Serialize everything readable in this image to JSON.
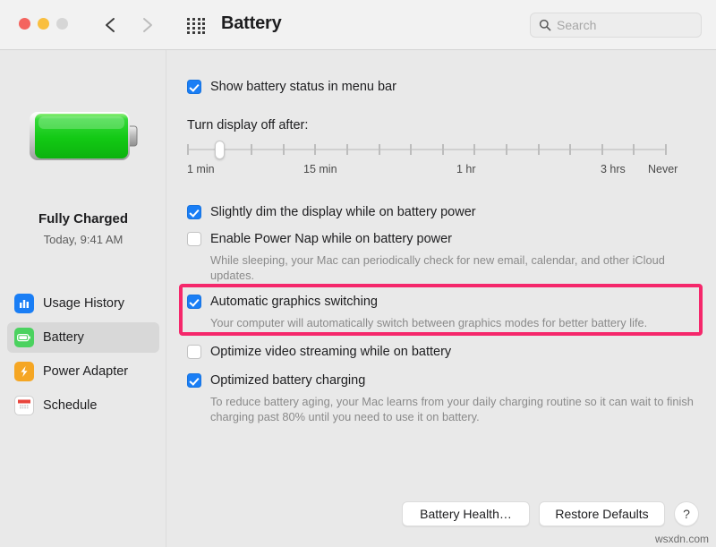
{
  "window": {
    "title": "Battery",
    "traffic_lights": [
      "close",
      "minimize",
      "zoom"
    ],
    "back_icon": "chevron-left-icon",
    "forward_icon": "chevron-right-icon",
    "grid_icon": "show-all-grid-icon"
  },
  "search": {
    "placeholder": "Search",
    "value": "",
    "icon": "search-icon"
  },
  "sidebar": {
    "battery_icon": "battery-full-green-icon",
    "status_title": "Fully Charged",
    "status_sub": "Today, 9:41 AM",
    "items": [
      {
        "label": "Usage History",
        "icon": "usage-history-icon",
        "selected": false
      },
      {
        "label": "Battery",
        "icon": "battery-icon",
        "selected": true
      },
      {
        "label": "Power Adapter",
        "icon": "power-adapter-bolt-icon",
        "selected": false
      },
      {
        "label": "Schedule",
        "icon": "schedule-calendar-icon",
        "selected": false
      }
    ]
  },
  "main": {
    "show_status": {
      "label": "Show battery status in menu bar",
      "checked": true
    },
    "display_off": {
      "label": "Turn display off after:",
      "ticks": 16,
      "thumb_index": 1,
      "scale_labels": [
        {
          "text": "1 min",
          "pos": 0
        },
        {
          "text": "15 min",
          "pos": 130
        },
        {
          "text": "1 hr",
          "pos": 301
        },
        {
          "text": "3 hrs",
          "pos": 462
        },
        {
          "text": "Never",
          "pos": 515
        }
      ]
    },
    "options": [
      {
        "label": "Slightly dim the display while on battery power",
        "checked": true,
        "description": ""
      },
      {
        "label": "Enable Power Nap while on battery power",
        "checked": false,
        "description": "While sleeping, your Mac can periodically check for new email, calendar, and other iCloud updates."
      },
      {
        "label": "Automatic graphics switching",
        "checked": true,
        "description": "Your computer will automatically switch between graphics modes for better battery life.",
        "highlighted": true
      },
      {
        "label": "Optimize video streaming while on battery",
        "checked": false,
        "description": ""
      },
      {
        "label": "Optimized battery charging",
        "checked": true,
        "description": "To reduce battery aging, your Mac learns from your daily charging routine so it can wait to finish charging past 80% until you need to use it on battery."
      }
    ]
  },
  "footer": {
    "battery_health_label": "Battery Health…",
    "restore_defaults_label": "Restore Defaults",
    "help_label": "?"
  },
  "watermark": "wsxdn.com",
  "colors": {
    "accent_blue": "#1a7ef5",
    "highlight_pink": "#f5276b",
    "battery_green": "#2fd335",
    "window_bg": "#e9e9e9",
    "toolbar_bg": "#f2f2f2"
  }
}
